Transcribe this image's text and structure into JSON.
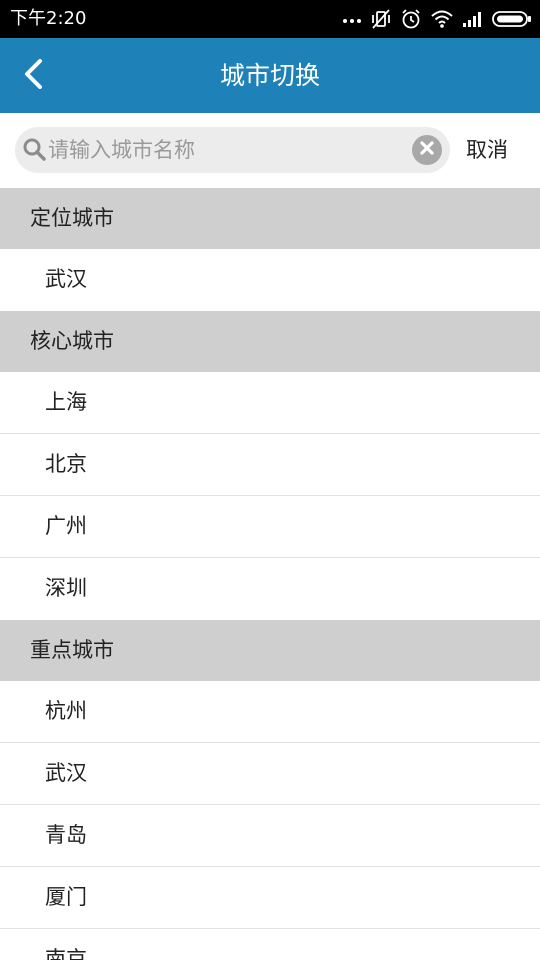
{
  "status_bar": {
    "time": "下午2:20",
    "icons": [
      "more-dots-icon",
      "vibrate-off-icon",
      "alarm-icon",
      "wifi-icon",
      "signal-icon",
      "battery-icon"
    ]
  },
  "header": {
    "title": "城市切换",
    "background_color": "#1e82b8"
  },
  "search": {
    "placeholder": "请输入城市名称",
    "value": "",
    "cancel_label": "取消"
  },
  "sections": [
    {
      "title": "定位城市",
      "cities": [
        "武汉"
      ]
    },
    {
      "title": "核心城市",
      "cities": [
        "上海",
        "北京",
        "广州",
        "深圳"
      ]
    },
    {
      "title": "重点城市",
      "cities": [
        "杭州",
        "武汉",
        "青岛",
        "厦门",
        "南京"
      ]
    }
  ]
}
